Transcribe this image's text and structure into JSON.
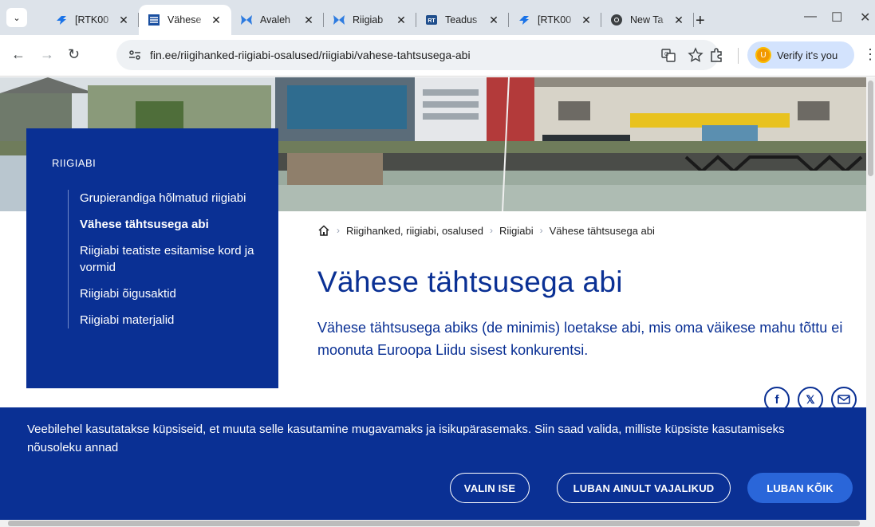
{
  "browser": {
    "tabs": [
      {
        "title": "[RTK00",
        "icon": "rtk-icon",
        "active": false
      },
      {
        "title": "Vähese",
        "icon": "fin-crest-icon",
        "active": true
      },
      {
        "title": "Avaleh",
        "icon": "butterfly-icon",
        "active": false
      },
      {
        "title": "Riigiab",
        "icon": "butterfly-icon",
        "active": false
      },
      {
        "title": "Teadus",
        "icon": "rt-icon",
        "active": false
      },
      {
        "title": "[RTK00",
        "icon": "rtk-icon",
        "active": false
      },
      {
        "title": "New Ta",
        "icon": "chrome-icon",
        "active": false
      }
    ],
    "close_glyph": "✕",
    "new_tab_glyph": "+",
    "url": "fin.ee/riigihanked-riigiabi-osalused/riigiabi/vahese-tahtsusega-abi",
    "verify_label": "Verify it's you",
    "colors": {
      "tabbar": "#dde3ea",
      "omnibox": "#eef1f4",
      "verify": "#d3e3fd"
    }
  },
  "sidenav": {
    "heading": "RIIGIABI",
    "items": [
      {
        "label": "Grupierandiga hõlmatud riigiabi",
        "active": false
      },
      {
        "label": "Vähese tähtsusega abi",
        "active": true
      },
      {
        "label": "Riigiabi teatiste esitamise kord ja vormid",
        "active": false
      },
      {
        "label": "Riigiabi õigusaktid",
        "active": false
      },
      {
        "label": "Riigiabi materjalid",
        "active": false
      }
    ]
  },
  "breadcrumb": [
    "Riigihanked, riigiabi, osalused",
    "Riigiabi",
    "Vähese tähtsusega abi"
  ],
  "page": {
    "title": "Vähese tähtsusega abi",
    "lead": "Vähese tähtsusega abiks (de minimis) loetakse abi, mis oma väikese mahu tõttu ei moonuta Euroopa Liidu sisest konkurentsi."
  },
  "share": {
    "facebook": "f",
    "x": "𝕏"
  },
  "cookie": {
    "text": "Veebilehel kasutatakse küpsiseid, et muuta selle kasutamine mugavamaks ja isikupärasemaks. Siin saad valida, milliste küpsiste kasutamiseks nõusoleku annad",
    "buttons": [
      "VALIN ISE",
      "LUBAN AINULT VAJALIKUD",
      "LUBAN KÕIK"
    ]
  },
  "theme": {
    "brand_blue": "#0a3094",
    "button_blue": "#2a66d9"
  }
}
